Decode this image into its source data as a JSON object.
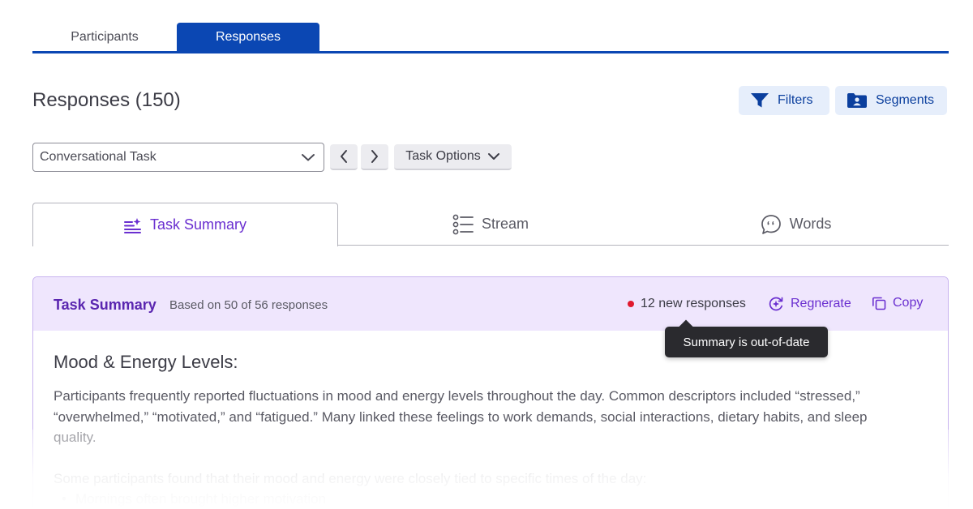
{
  "top_tabs": [
    {
      "label": "Participants",
      "active": false
    },
    {
      "label": "Responses",
      "active": true
    }
  ],
  "header": {
    "title": "Responses (150)",
    "filters_label": "Filters",
    "segments_label": "Segments"
  },
  "toolbar": {
    "task_select_value": "Conversational Task",
    "task_options_label": "Task Options"
  },
  "view_tabs": [
    {
      "label": "Task Summary",
      "icon": "sparkle-list-icon",
      "active": true
    },
    {
      "label": "Stream",
      "icon": "list-icon",
      "active": false
    },
    {
      "label": "Words",
      "icon": "speech-bubble-icon",
      "active": false
    }
  ],
  "summary_card": {
    "title": "Task Summary",
    "subtitle": "Based on 50 of 56 responses",
    "new_responses": "12 new responses",
    "regenerate_label": "Regnerate",
    "copy_label": "Copy",
    "tooltip": "Summary is out-of-date",
    "section_title": "Mood & Energy Levels:",
    "paragraph_1": "Participants frequently reported fluctuations in mood and energy levels throughout the day. Common descriptors included “stressed,” “overwhelmed,” “motivated,” and “fatigued.” Many linked these feelings to work demands, social interactions, dietary habits, and sleep quality.",
    "paragraph_2": "Some participants found that their mood and energy were closely tied to specific times of the day:",
    "bullet_1": "Mornings often brought higher motivation"
  },
  "colors": {
    "primary_blue": "#0b47b3",
    "accent_purple": "#6a2fd0",
    "card_header_bg": "#efe6fd",
    "alert_red": "#e0192e"
  }
}
